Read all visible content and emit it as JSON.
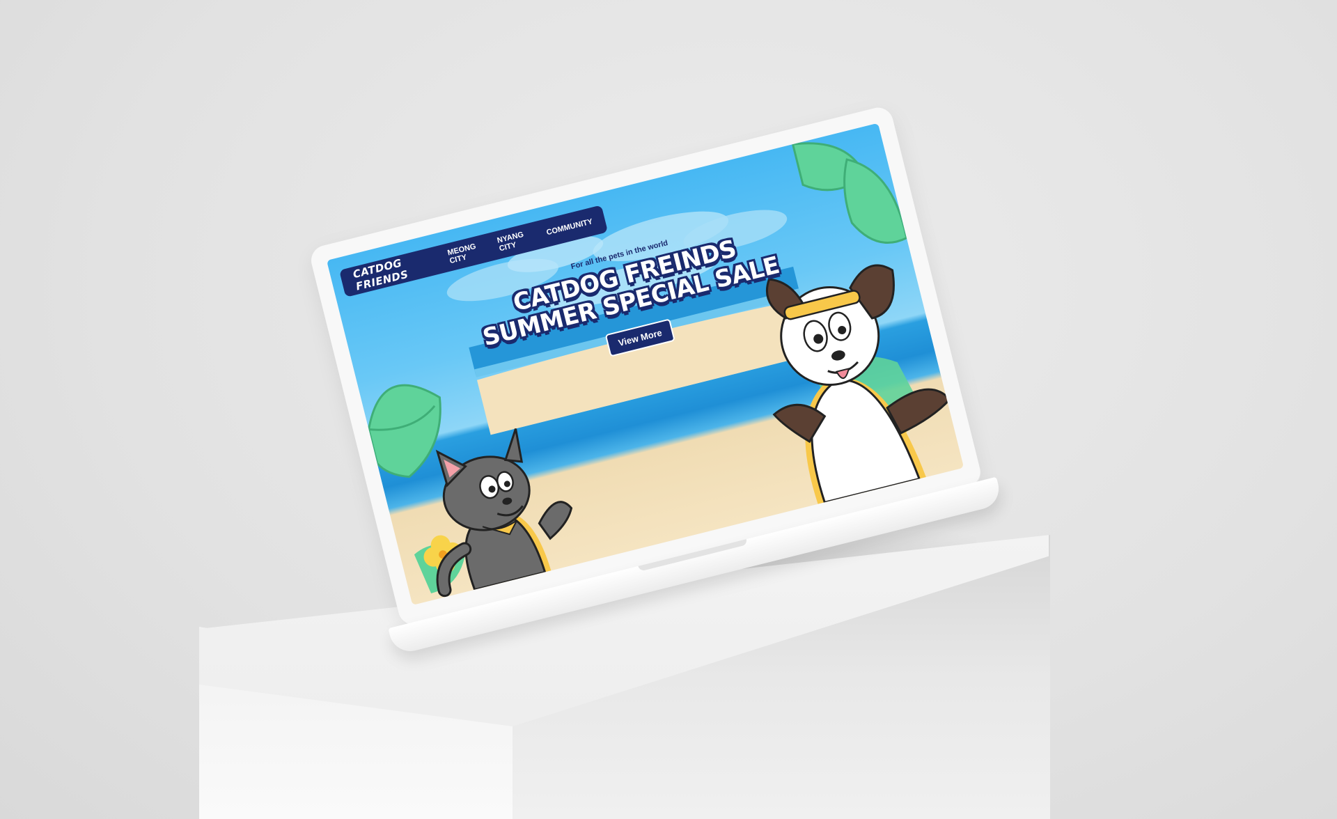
{
  "site": {
    "brand": "CATDOG FRIENDS",
    "nav": [
      {
        "label": "MEONG CITY"
      },
      {
        "label": "NYANG CITY"
      },
      {
        "label": "COMMUNITY"
      }
    ]
  },
  "hero": {
    "tagline": "For all the pets in the world",
    "headline_line1": "CATDOG FREINDS",
    "headline_line2": "SUMMER SPECIAL SALE",
    "cta_label": "View More"
  },
  "colors": {
    "navy": "#1a2a6e",
    "sky": "#47b8f3",
    "sand": "#f5e4c1",
    "leaf": "#5fd39a",
    "accent_yellow": "#f8c84a"
  },
  "icons": {
    "cat": "cat-character-icon",
    "dog": "dog-character-icon",
    "leaves": "palm-leaf-icon",
    "flower": "hibiscus-flower-icon"
  }
}
